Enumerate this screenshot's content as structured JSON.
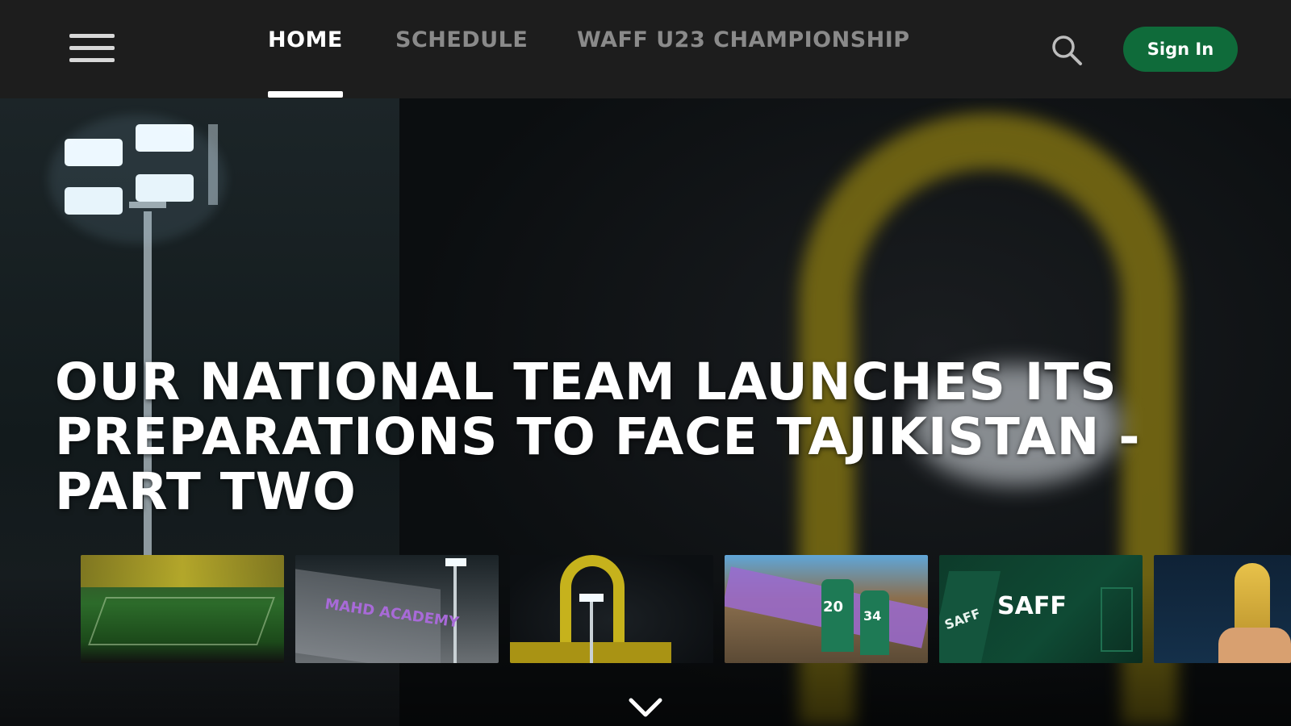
{
  "header": {
    "menu_icon": "hamburger-menu-icon",
    "tabs": [
      {
        "label": "HOME",
        "active": true
      },
      {
        "label": "SCHEDULE",
        "active": false
      },
      {
        "label": "WAFF U23 CHAMPIONSHIP",
        "active": false
      }
    ],
    "search_icon": "search-icon",
    "signin_label": "Sign In"
  },
  "hero": {
    "title": "OUR NATIONAL TEAM LAUNCHES ITS PREPARATIONS TO FACE TAJIKISTAN - PART TWO"
  },
  "thumbnails": [
    {
      "label": ""
    },
    {
      "label": "MAHD ACADEMY"
    },
    {
      "label": ""
    },
    {
      "label": ""
    },
    {
      "label": "SAFF",
      "label_small": "SAFF"
    },
    {
      "label": ""
    }
  ],
  "scroll_icon": "chevron-down-icon",
  "colors": {
    "topbar_bg": "#1d1d1d",
    "signin_bg": "#0f6b3a",
    "active_tab": "#ffffff",
    "inactive_tab": "#8a8a8a"
  }
}
